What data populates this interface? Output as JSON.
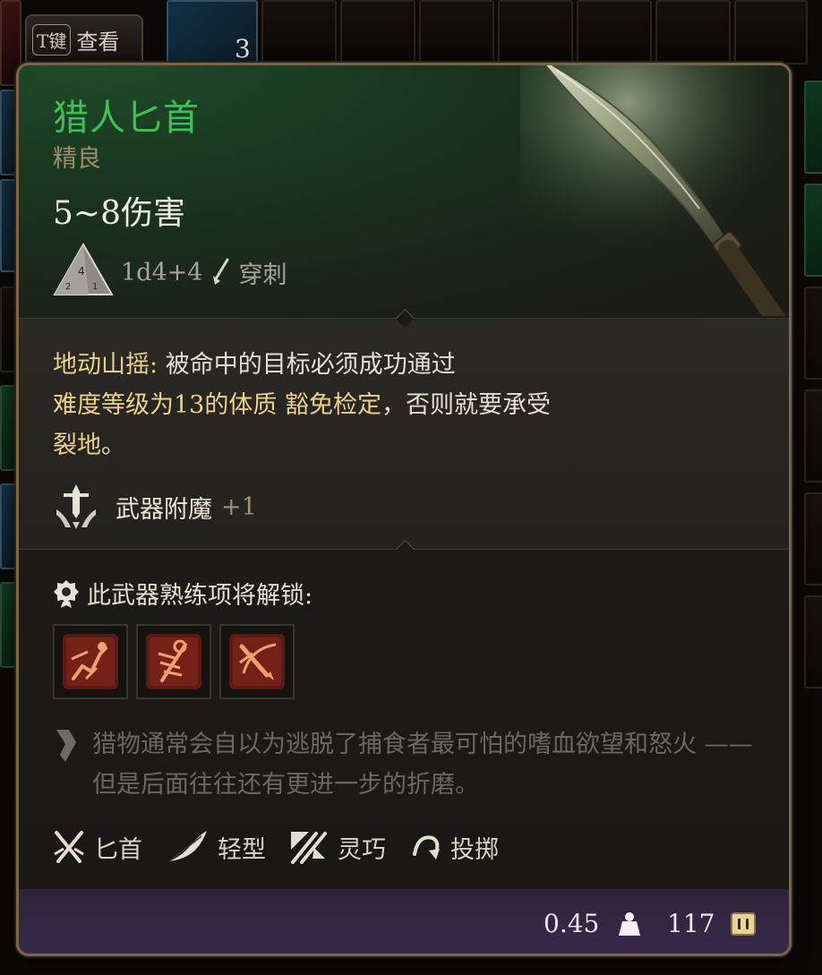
{
  "hint": {
    "key": "T键",
    "label": "查看"
  },
  "stack_count": "3",
  "item": {
    "name": "猎人匕首",
    "rarity": "精良",
    "damage": "5~8伤害",
    "dice": "1d4+4",
    "damage_type": "穿刺"
  },
  "effect": {
    "name": "地动山摇:",
    "text1": " 被命中的目标必须成功通过",
    "text2": "难度等级为13的体质 ",
    "save": "豁免检定",
    "text3": "，否则就要承受",
    "condition": "裂地",
    "text4": "。"
  },
  "enchant": {
    "label": "武器附魔",
    "bonus": "+1"
  },
  "proficiency": {
    "label": "此武器熟练项将解锁:"
  },
  "flavor": "猎物通常会自以为逃脱了捕食者最可怕的嗜血欲望和怒火 —— 但是后面往往还有更进一步的折磨。",
  "tags": [
    {
      "label": "匕首",
      "icon": "crossed-daggers-icon"
    },
    {
      "label": "轻型",
      "icon": "feather-icon"
    },
    {
      "label": "灵巧",
      "icon": "finesse-icon"
    },
    {
      "label": "投掷",
      "icon": "throw-icon"
    }
  ],
  "footer": {
    "weight": "0.45",
    "value": "117"
  },
  "colors": {
    "name": "#3fbf56",
    "rarity": "#a08c6a",
    "highlight": "#ecd18a",
    "border": "#7a6548",
    "footer": "#3a2a4e"
  }
}
